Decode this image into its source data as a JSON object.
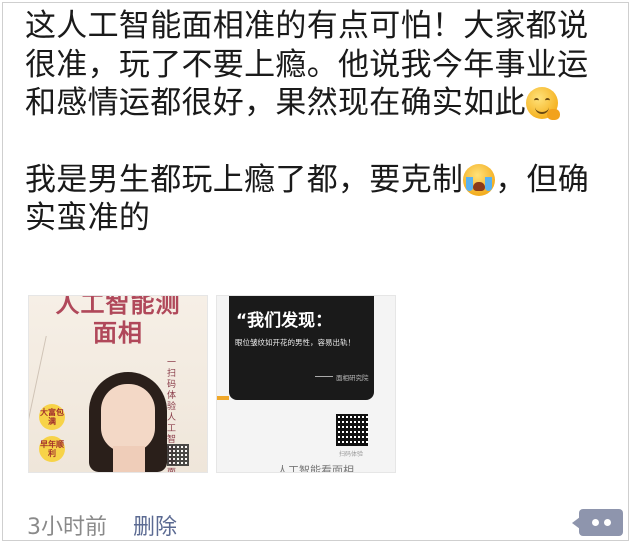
{
  "post": {
    "paragraph1": "这人工智能面相准的有点可怕！大家都说很准，玩了不要上瘾。他说我今年事业运和感情运都很好，果然现在确实如此",
    "emoji1": "smirk-hand-emoji",
    "paragraph2a": "我是男生都玩上瘾了都，要克制",
    "emoji2": "crying-laughing-emoji",
    "paragraph2b": "，但确实蛮准的"
  },
  "images": {
    "thumb1": {
      "title_line1": "人工智能测",
      "title_line2": "面相",
      "vertical_text1": "一扫码体验人工智能看面相",
      "badge1": "大富包满",
      "badge2": "早年顺利"
    },
    "thumb2": {
      "headline": "“我们发现：",
      "subline": "眼位皱纹如开花的男性，容易出轨！",
      "source": "面相研究院",
      "qr_caption": "扫码体验",
      "footer": "人工智能看面相"
    }
  },
  "footer": {
    "time": "3小时前",
    "delete_label": "删除"
  },
  "colors": {
    "text": "#1a1a1a",
    "meta": "#8a8a8a",
    "link": "#5b6a92",
    "comment_button": "#8e95ad"
  }
}
